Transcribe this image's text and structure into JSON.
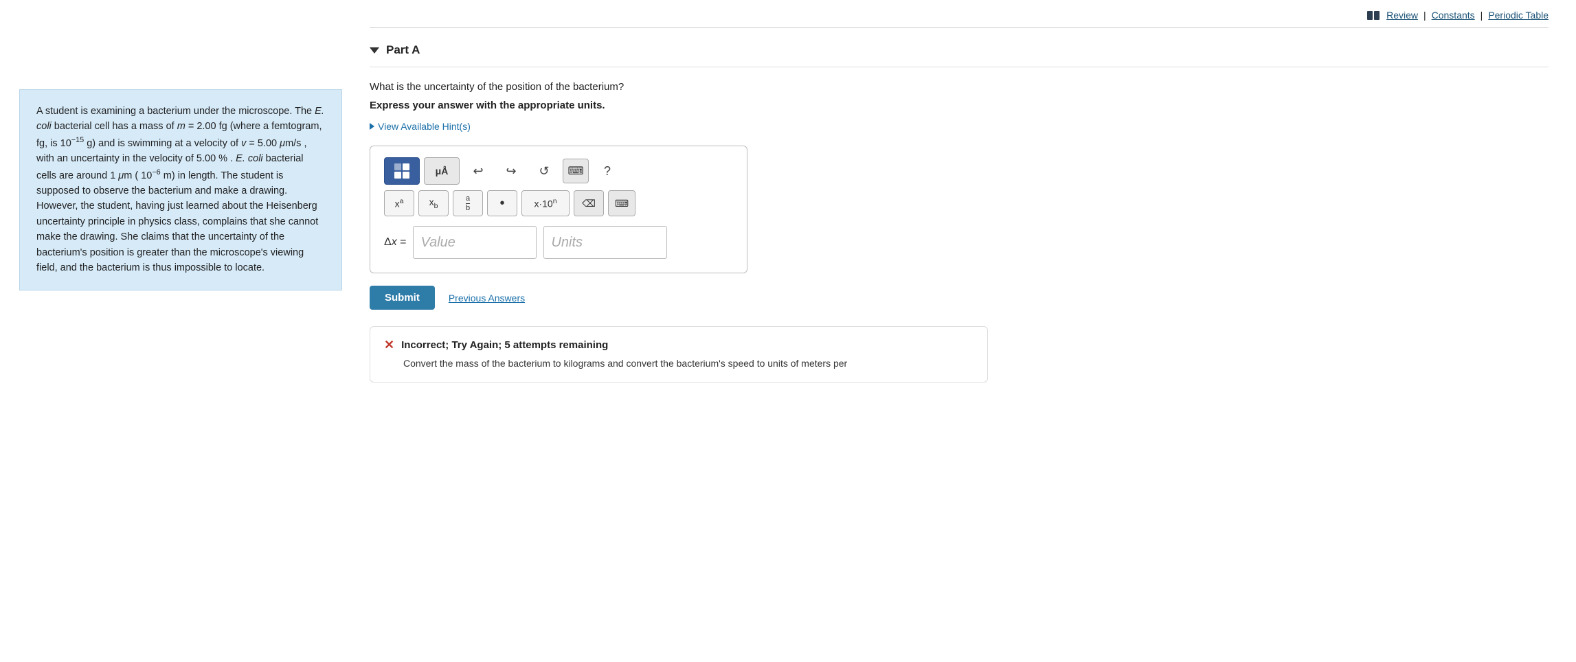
{
  "topbar": {
    "review_label": "Review",
    "constants_label": "Constants",
    "periodic_table_label": "Periodic Table",
    "separator": "|"
  },
  "left_panel": {
    "text_parts": [
      "A student is examining a bacterium under the microscope. The ",
      "E. coli",
      " bacterial cell has a mass of ",
      "m = 2.00 fg (where a femtogram, fg,  is 10",
      "−15",
      " g) and is swimming at a velocity of v = 5.00 μm/s , with an uncertainty in the velocity of 5.00 % . ",
      "E. coli",
      " bacterial cells are around 1 μm ( 10",
      "−6",
      " m) in length. The student is supposed to observe the bacterium and make a drawing. However, the student, having just learned about the Heisenberg uncertainty principle in physics class, complains that she cannot make the drawing. She claims that the uncertainty of the bacterium's position is greater than the microscope's viewing field, and the bacterium is thus impossible to locate."
    ]
  },
  "part_a": {
    "label": "Part A",
    "question": "What is the uncertainty of the position of the bacterium?",
    "instruction": "Express your answer with the appropriate units.",
    "hint_label": "View Available Hint(s)",
    "toolbar": {
      "btn1_label": "μÅ",
      "undo_label": "↩",
      "redo_label": "↪",
      "refresh_label": "↺",
      "keyboard_label": "⌨",
      "help_label": "?"
    },
    "math_buttons": [
      {
        "label": "xᵃ",
        "id": "superscript"
      },
      {
        "label": "xᵦ",
        "id": "subscript"
      },
      {
        "label": "a/b",
        "id": "fraction"
      },
      {
        "label": "•",
        "id": "dot"
      },
      {
        "label": "x·10ⁿ",
        "id": "scientific"
      },
      {
        "label": "⌫",
        "id": "backspace"
      },
      {
        "label": "⌨",
        "id": "keyboard2"
      }
    ],
    "delta_x_label": "Δx =",
    "value_placeholder": "Value",
    "units_placeholder": "Units",
    "submit_label": "Submit",
    "prev_answers_label": "Previous Answers"
  },
  "error": {
    "title": "Incorrect; Try Again; 5 attempts remaining",
    "text": "Convert the mass of the bacterium to kilograms and convert the bacterium's speed to units of meters per"
  }
}
